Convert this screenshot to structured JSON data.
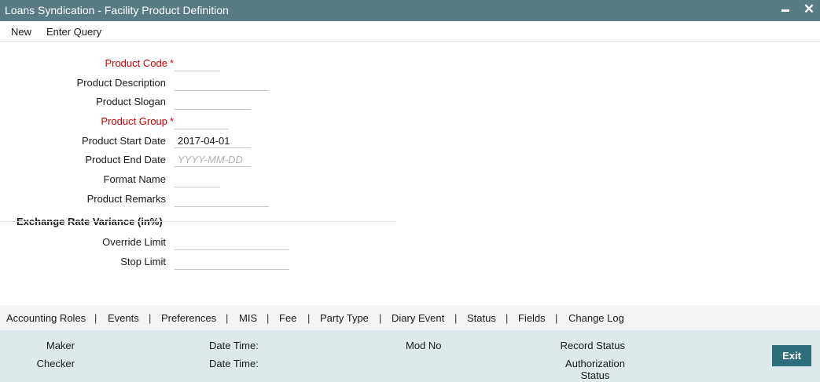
{
  "window": {
    "title": "Loans Syndication - Facility Product Definition"
  },
  "toolbar": {
    "items": [
      "New",
      "Enter Query"
    ]
  },
  "form": {
    "product_code_label": "Product Code",
    "product_description_label": "Product Description",
    "product_slogan_label": "Product Slogan",
    "product_group_label": "Product Group",
    "product_start_date_label": "Product Start Date",
    "product_start_date_value": "2017-04-01",
    "product_end_date_label": "Product End Date",
    "product_end_date_placeholder": "YYYY-MM-DD",
    "format_name_label": "Format Name",
    "product_remarks_label": "Product Remarks",
    "required_marker": "*"
  },
  "exchange_rate_section": {
    "title": "Exchange Rate Variance (in%)",
    "override_limit_label": "Override Limit",
    "stop_limit_label": "Stop Limit"
  },
  "tabs": {
    "items": [
      "Accounting Roles",
      "Events",
      "Preferences",
      "MIS",
      "Fee",
      "Party Type",
      "Diary Event",
      "Status",
      "Fields",
      "Change Log"
    ],
    "separator": "|"
  },
  "footer": {
    "maker_label": "Maker",
    "checker_label": "Checker",
    "date_time_label": "Date Time:",
    "mod_no_label": "Mod No",
    "record_status_label": "Record Status",
    "authorization_status_line1": "Authorization",
    "authorization_status_line2": "Status",
    "exit_label": "Exit"
  }
}
